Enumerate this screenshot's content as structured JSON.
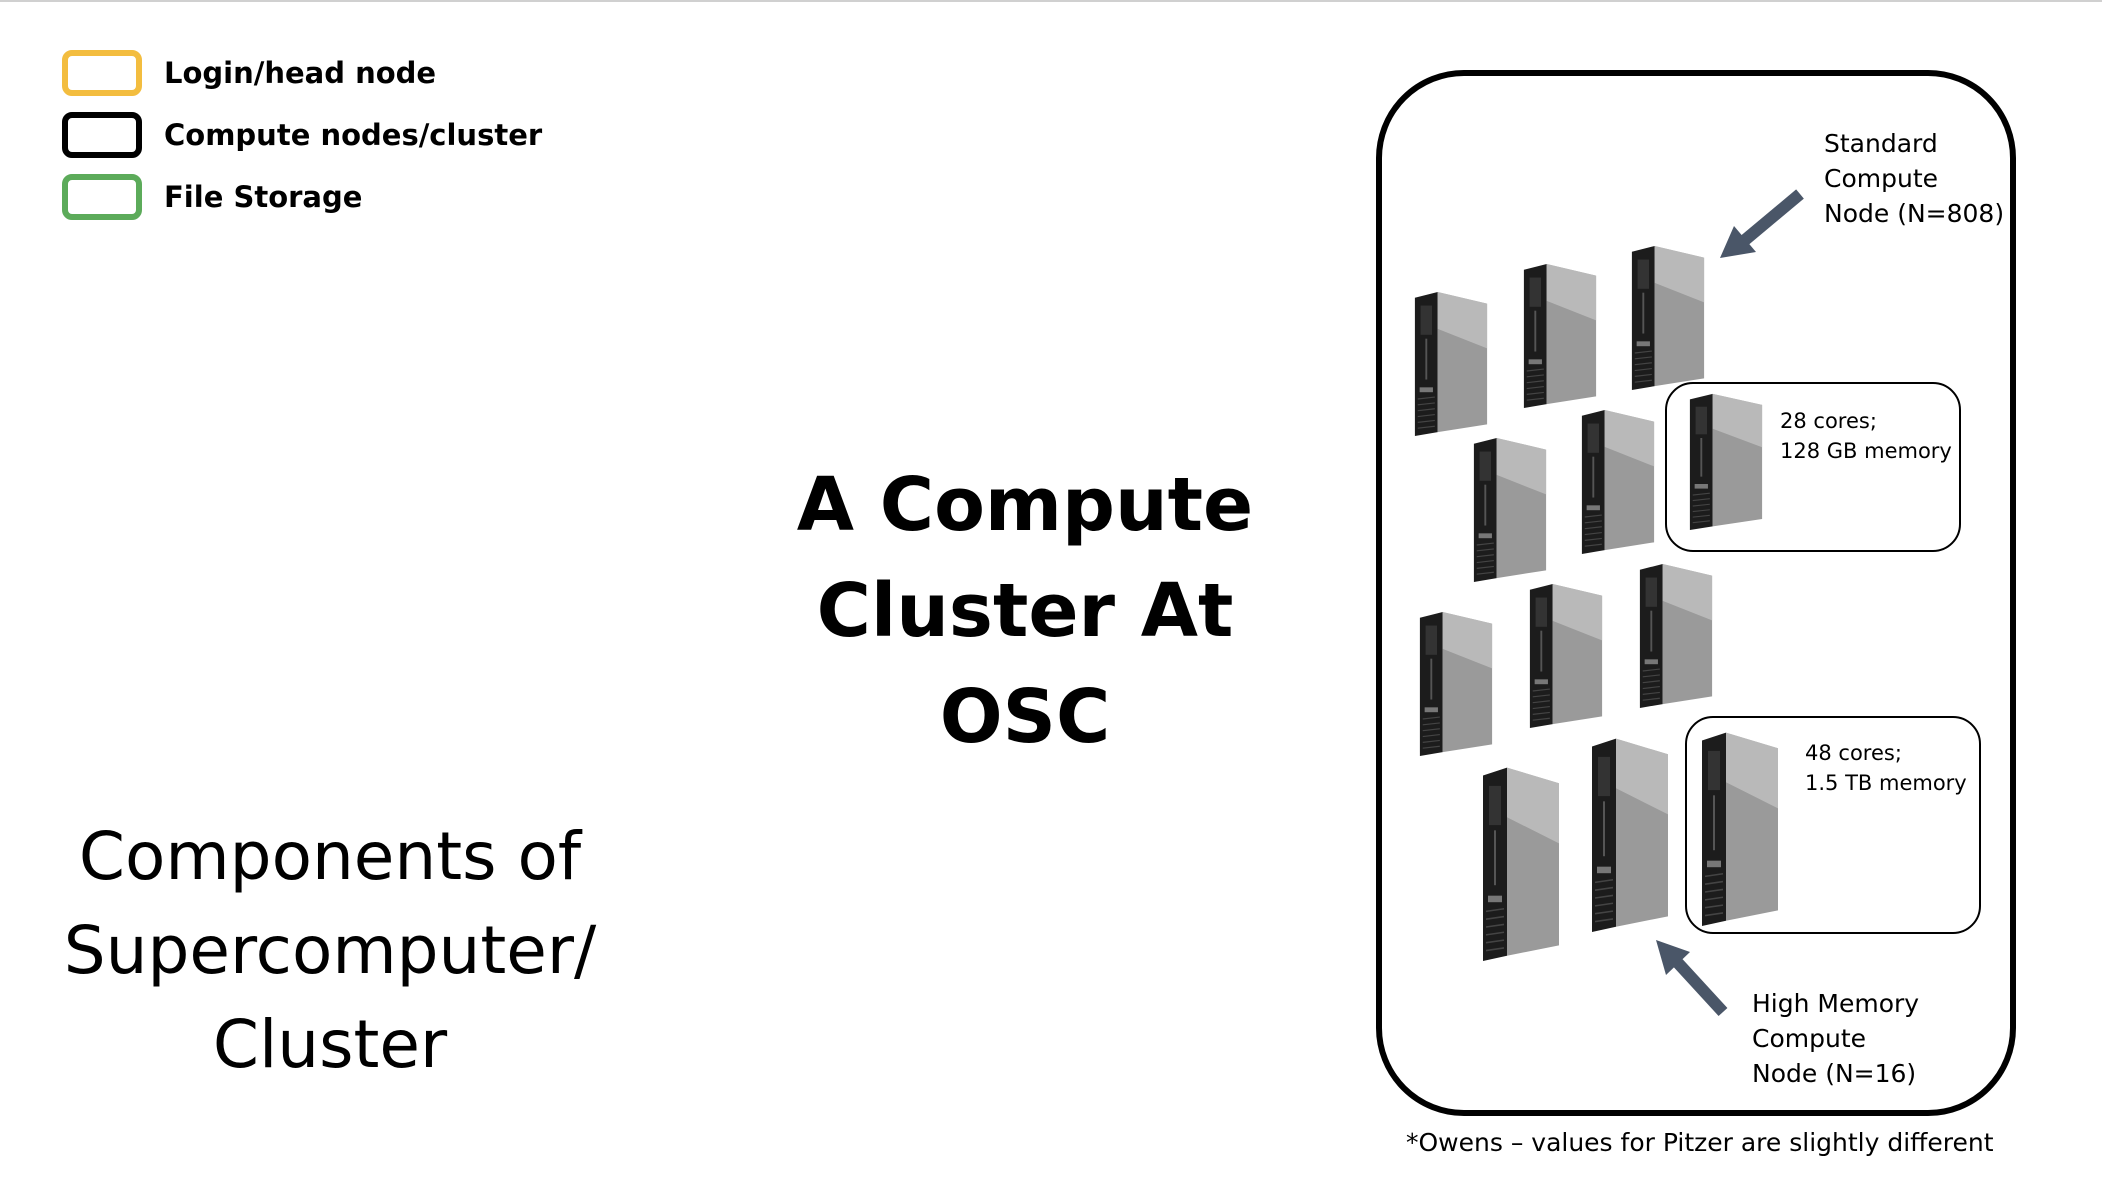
{
  "legend": [
    {
      "label": "Login/head node",
      "color": "#f3bd3f"
    },
    {
      "label": "Compute nodes/cluster",
      "color": "#000000"
    },
    {
      "label": "File Storage",
      "color": "#5cab5a"
    }
  ],
  "left_title": {
    "lines": [
      "Components of",
      "Supercomputer/",
      "Cluster"
    ]
  },
  "center_title": {
    "lines": [
      "A Compute",
      "Cluster At OSC"
    ]
  },
  "standard_node": {
    "lines": [
      "Standard",
      "Compute",
      "Node (N=808)"
    ]
  },
  "standard_specs": {
    "lines": [
      "28 cores;",
      "128 GB memory"
    ]
  },
  "highmem_specs": {
    "lines": [
      "48 cores;",
      "1.5 TB memory"
    ]
  },
  "highmem_node": {
    "lines": [
      "High Memory",
      "Compute",
      "Node (N=16)"
    ]
  },
  "footnote": "*Owens – values for Pitzer are slightly different",
  "icons": {
    "computer": "desktop-tower-icon",
    "pointer": "arrow-icon"
  },
  "colors": {
    "arrow": "#4a5668",
    "frame": "#000000"
  }
}
